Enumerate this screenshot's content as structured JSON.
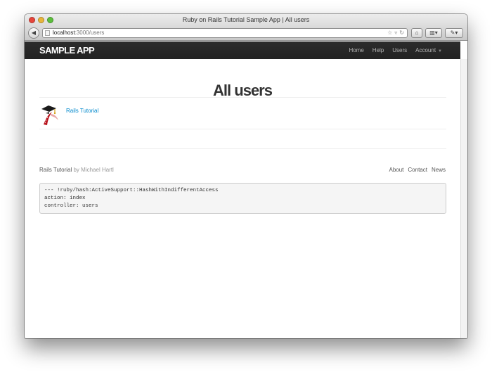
{
  "window": {
    "title": "Ruby on Rails Tutorial Sample App | All users"
  },
  "toolbar": {
    "url_host": "localhost",
    "url_path": ":3000/users"
  },
  "navbar": {
    "logo": "sample app",
    "links": [
      "Home",
      "Help",
      "Users",
      "Account"
    ]
  },
  "main": {
    "page_title": "All users",
    "users": [
      {
        "name": "Rails Tutorial"
      }
    ]
  },
  "footer": {
    "brand": "Rails Tutorial",
    "byline": "by Michael Hartl",
    "links": [
      "About",
      "Contact",
      "News"
    ]
  },
  "debug": {
    "lines": [
      "--- !ruby/hash:ActiveSupport::HashWithIndifferentAccess",
      "action: index",
      "controller: users"
    ]
  },
  "colors": {
    "navbar_bg": "#222222",
    "link": "#0088cc"
  }
}
